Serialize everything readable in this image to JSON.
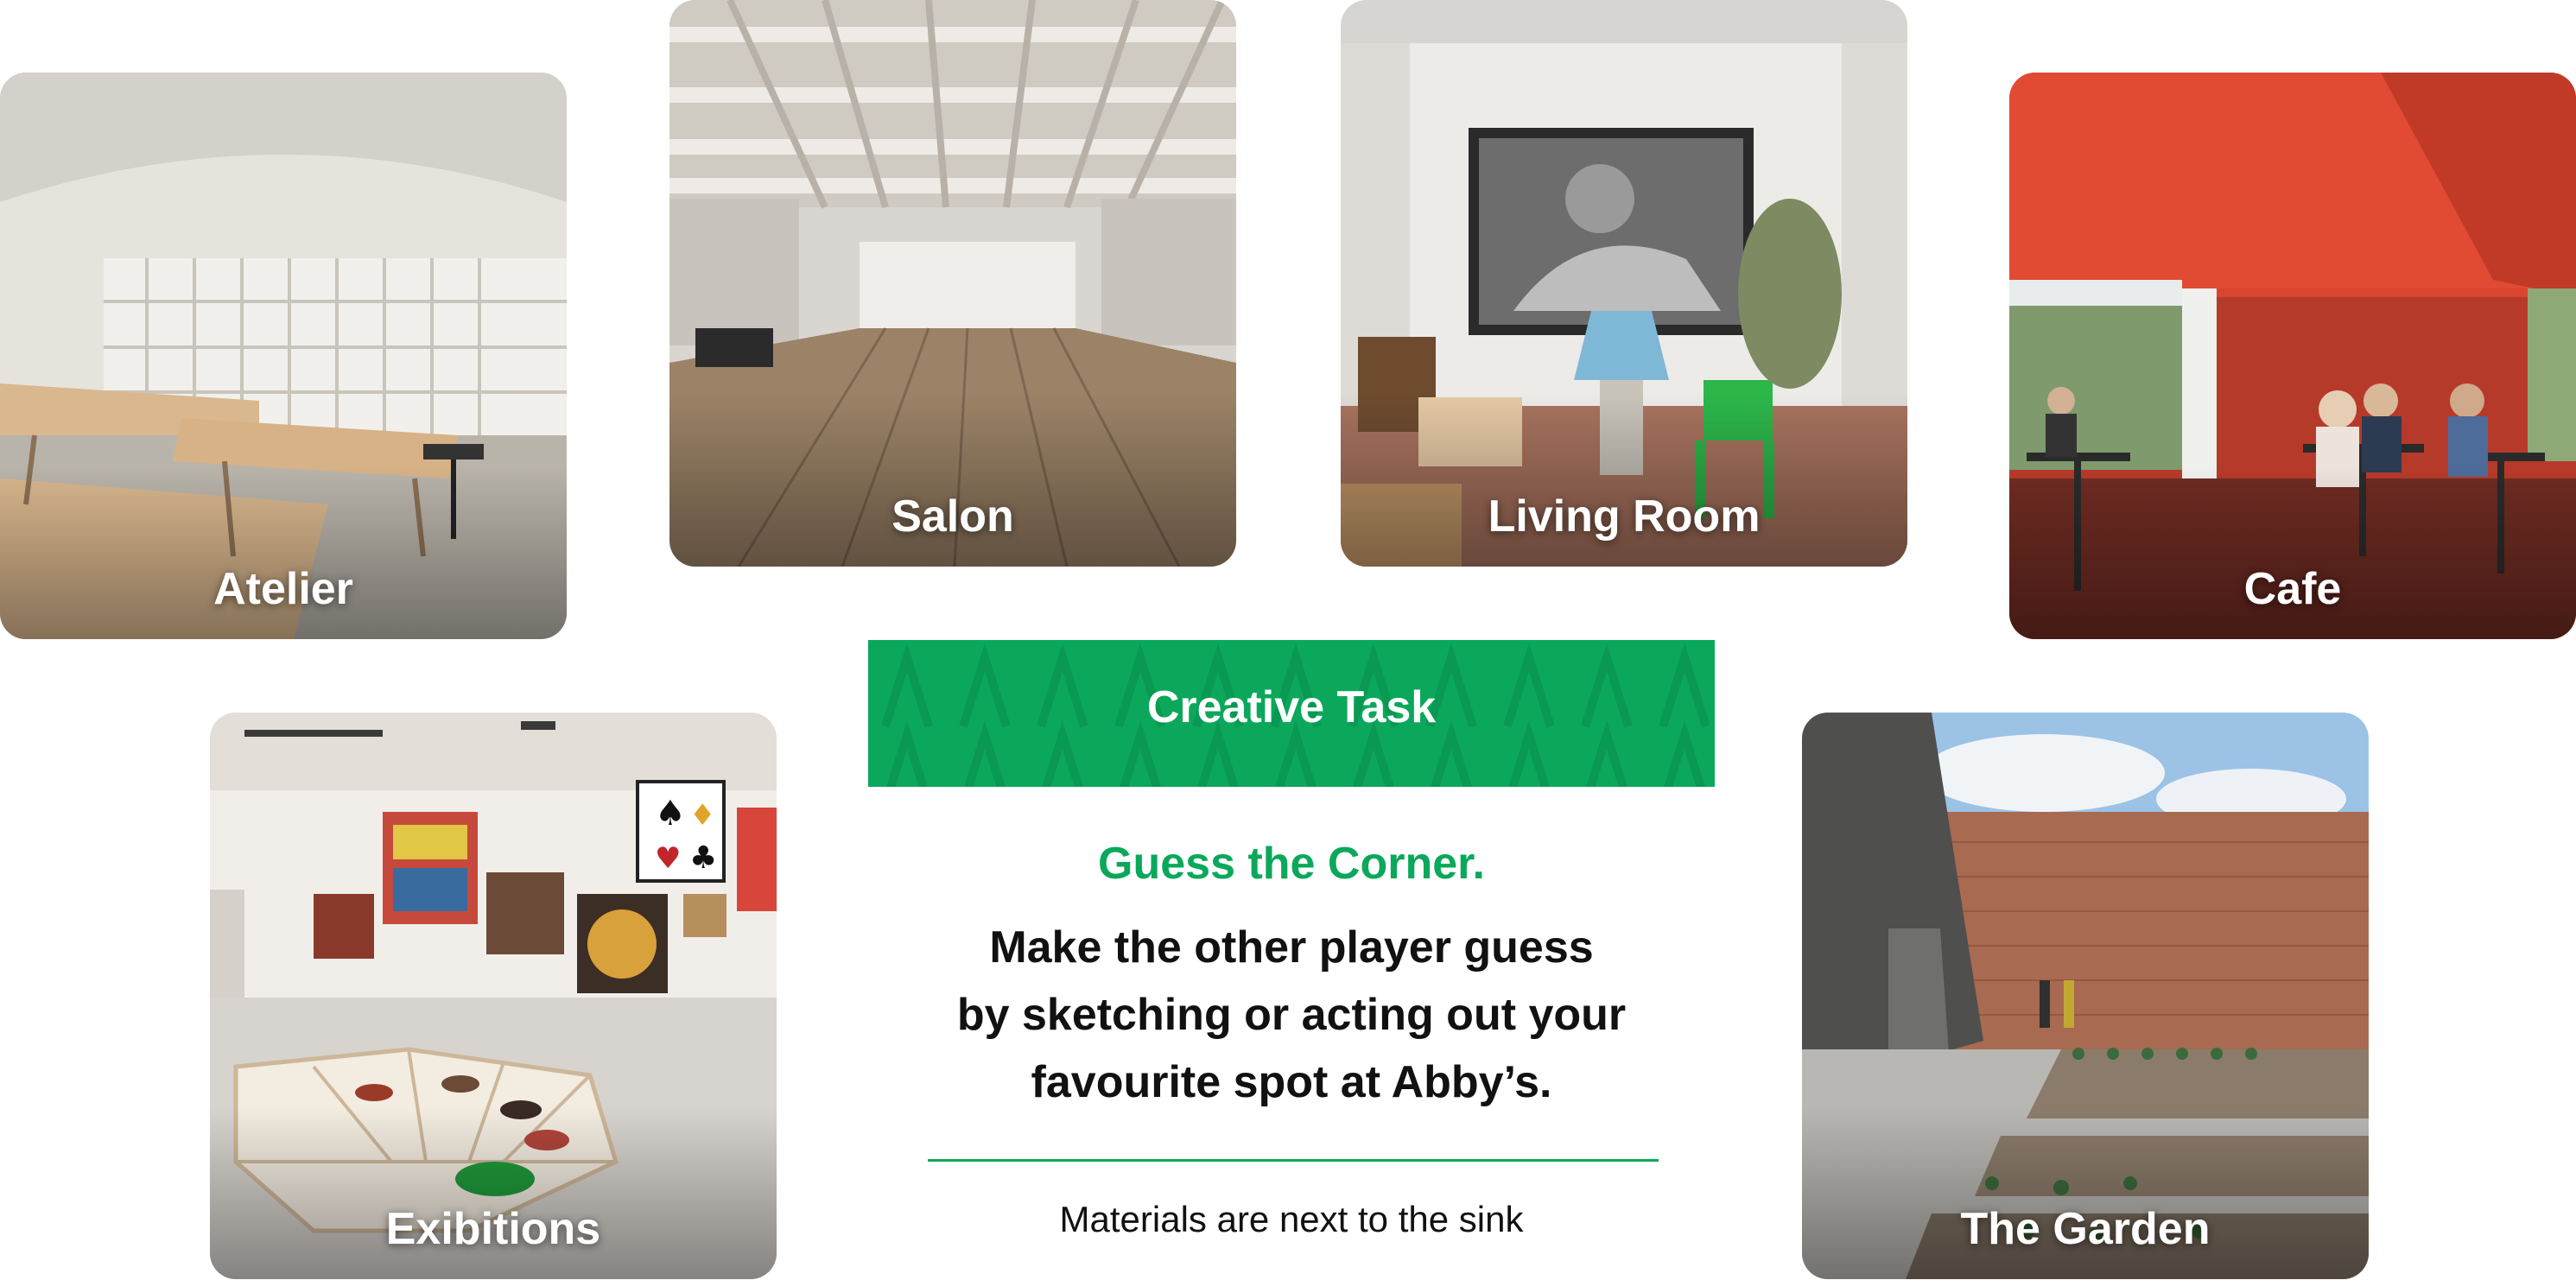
{
  "cards": [
    {
      "id": "atelier",
      "label": "Atelier"
    },
    {
      "id": "salon",
      "label": "Salon"
    },
    {
      "id": "living-room",
      "label": "Living Room"
    },
    {
      "id": "cafe",
      "label": "Cafe"
    },
    {
      "id": "exibitions",
      "label": "Exibitions"
    },
    {
      "id": "garden",
      "label": "The Garden"
    }
  ],
  "task": {
    "banner_title": "Creative Task",
    "headline": "Guess the Corner.",
    "lines": [
      "Make the other player guess",
      "by sketching or acting out your",
      "favourite spot at Abby’s."
    ],
    "note": "Materials are next to the sink"
  },
  "colors": {
    "brand_green": "#0ba85b",
    "text_dark": "#111111",
    "background": "#ffffff"
  }
}
